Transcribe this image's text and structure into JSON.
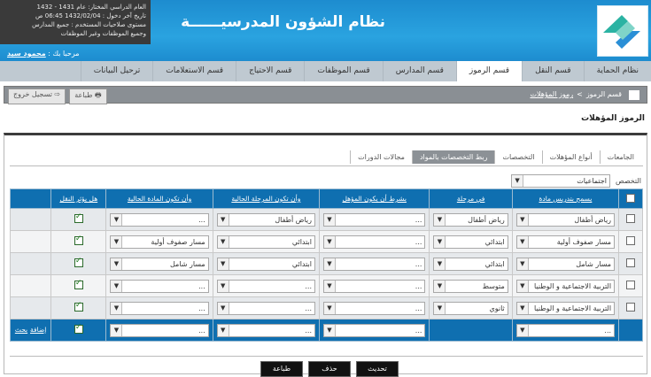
{
  "header": {
    "title": "نظام الشؤون المدرسيــــــة",
    "info": {
      "line1": "العام الدراسي المختار: عام 1431 - 1432",
      "line2": "تاريخ آخر دخول : 1432/02/04 06:45 ص",
      "line3": "مستوى صلاحيات المستخدم : جميع المدارس",
      "line4": "وجميع الموظفات وغير الموظفات"
    },
    "welcome_prefix": "مرحبا بك :",
    "username": "محمود سيد"
  },
  "nav": {
    "tabs": [
      "نظام الحماية",
      "قسم النقل",
      "قسم الرموز",
      "قسم المدارس",
      "قسم الموظفات",
      "قسم الاحتياج",
      "قسم الاستعلامات",
      "ترحيل البيانات"
    ],
    "active_index": 2
  },
  "breadcrumb": {
    "root": "قسم الرموز",
    "sep": ">",
    "current": "رموز المؤهلات",
    "print": "طباعة",
    "logout": "تسجيل خروج"
  },
  "page_title": "الرموز المؤهلات",
  "subtabs": {
    "items": [
      "الجامعات",
      "أنواع المؤهلات",
      "التخصصات",
      "ربط التخصصات بالمواد",
      "مجالات الدورات"
    ],
    "active_index": 3
  },
  "specialization": {
    "label": "التخصص",
    "value": "اجتماعيات"
  },
  "table": {
    "headers": [
      "يسمح بتدريس مادة",
      "في مرحلة",
      "بشرط أن يكون المؤهل",
      "وأن تكون المرحلة الحالية",
      "وأن تكون المادة الحالية",
      "هل يؤثر النقل"
    ],
    "rows": [
      {
        "subject": "رياض أطفال",
        "stage": "رياض أطفال",
        "qual": "...",
        "cur_stage": "رياض أطفال",
        "cur_subject": "...",
        "affects": true
      },
      {
        "subject": "مسار صفوف أولية",
        "stage": "ابتدائي",
        "qual": "...",
        "cur_stage": "ابتدائي",
        "cur_subject": "مسار صفوف أولية",
        "affects": true
      },
      {
        "subject": "مسار شامل",
        "stage": "ابتدائي",
        "qual": "...",
        "cur_stage": "ابتدائي",
        "cur_subject": "مسار شامل",
        "affects": true
      },
      {
        "subject": "التربية الاجتماعية و الوطنيا",
        "stage": "متوسط",
        "qual": "...",
        "cur_stage": "...",
        "cur_subject": "...",
        "affects": true
      },
      {
        "subject": "التربية الاجتماعية و الوطنيا",
        "stage": "ثانوي",
        "qual": "...",
        "cur_stage": "...",
        "cur_subject": "...",
        "affects": true
      }
    ],
    "footer": {
      "subject": "...",
      "qual": "...",
      "cur_stage": "...",
      "cur_subject": "...",
      "affects": true,
      "add": "إضافة",
      "search": "بحث"
    }
  },
  "buttons": {
    "update": "تحديث",
    "delete": "حذف",
    "print": "طباعة"
  },
  "colors": {
    "header": "#1d8ccf",
    "table_header": "#0f6fb0",
    "tab_bar": "#bfc9d1"
  }
}
